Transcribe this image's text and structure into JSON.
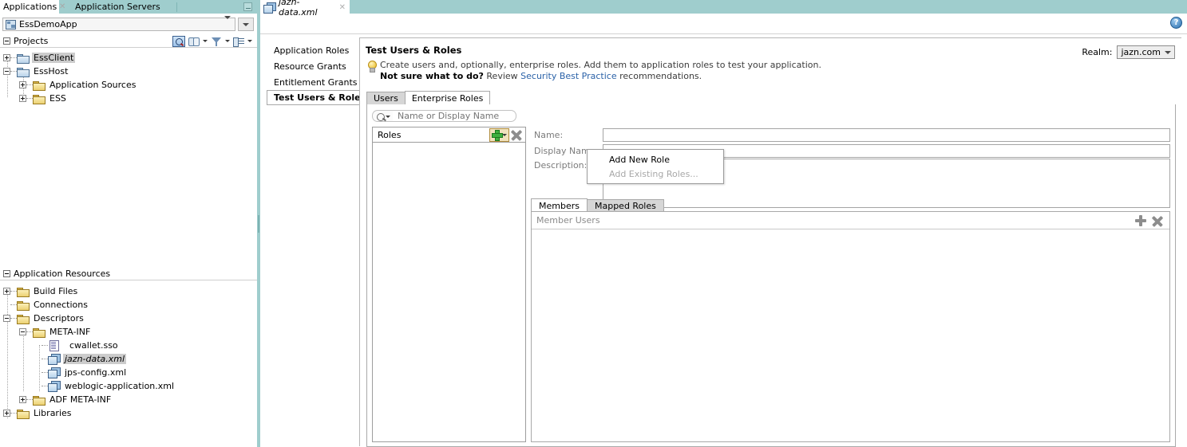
{
  "left_dock": {
    "tabs": [
      {
        "label": "Applications",
        "active": true,
        "closable": true
      },
      {
        "label": "Application Servers",
        "active": false,
        "closable": false
      }
    ],
    "minimize_icon": "minimize-icon",
    "app_selector": {
      "icon": "application-icon",
      "value": "EssDemoApp",
      "dropdown_icon": "chevron-down-icon",
      "secondary_dropdown_icon": "chevron-down-icon"
    },
    "projects_panel": {
      "title": "Projects",
      "collapse_icon": "collapse-icon",
      "tools": [
        {
          "name": "search-projects-icon",
          "has_menu": false
        },
        {
          "name": "working-sets-icon",
          "has_menu": true
        },
        {
          "name": "filter-icon",
          "has_menu": true
        },
        {
          "name": "view-options-icon",
          "has_menu": true
        }
      ],
      "tree": [
        {
          "label": "EssClient",
          "depth": 0,
          "expander": "plus",
          "icon": "folder-blue-icon",
          "selected": true
        },
        {
          "label": "EssHost",
          "depth": 0,
          "expander": "minus",
          "icon": "folder-blue-icon",
          "selected": false
        },
        {
          "label": "Application Sources",
          "depth": 1,
          "expander": "plus",
          "icon": "folder-icon",
          "selected": false
        },
        {
          "label": "ESS",
          "depth": 1,
          "expander": "plus",
          "icon": "folder-icon",
          "selected": false
        }
      ]
    },
    "resources_panel": {
      "title": "Application Resources",
      "collapse_icon": "collapse-icon",
      "tree": [
        {
          "label": "Build Files",
          "depth": 0,
          "expander": "plus",
          "icon": "folder-icon",
          "selected": false,
          "italic": false
        },
        {
          "label": "Connections",
          "depth": 0,
          "expander": "none",
          "icon": "folder-icon",
          "selected": false,
          "italic": false
        },
        {
          "label": "Descriptors",
          "depth": 0,
          "expander": "minus",
          "icon": "folder-icon",
          "selected": false,
          "italic": false
        },
        {
          "label": "META-INF",
          "depth": 1,
          "expander": "minus",
          "icon": "folder-icon",
          "selected": false,
          "italic": false
        },
        {
          "label": "cwallet.sso",
          "depth": 2,
          "expander": "none",
          "icon": "document-icon",
          "selected": false,
          "italic": false
        },
        {
          "label": "jazn-data.xml",
          "depth": 2,
          "expander": "none",
          "icon": "xml-file-icon",
          "selected": true,
          "italic": true
        },
        {
          "label": "jps-config.xml",
          "depth": 2,
          "expander": "none",
          "icon": "xml-file-icon",
          "selected": false,
          "italic": false
        },
        {
          "label": "weblogic-application.xml",
          "depth": 2,
          "expander": "none",
          "icon": "xml-file-icon",
          "selected": false,
          "italic": false
        },
        {
          "label": "ADF META-INF",
          "depth": 1,
          "expander": "plus",
          "icon": "folder-icon",
          "selected": false,
          "italic": false
        },
        {
          "label": "Libraries",
          "depth": 0,
          "expander": "plus",
          "icon": "folder-icon",
          "selected": false,
          "italic": false
        }
      ]
    }
  },
  "editor": {
    "tab": {
      "label": "jazn-data.xml",
      "icon": "xml-file-icon",
      "close_icon": "close-icon"
    },
    "help_icon": "help-icon",
    "help_glyph": "?",
    "nav_items": [
      {
        "label": "Application Roles",
        "active": false
      },
      {
        "label": "Resource Grants",
        "active": false
      },
      {
        "label": "Entitlement Grants",
        "active": false
      },
      {
        "label": "Test Users & Roles",
        "active": true
      }
    ],
    "page": {
      "title": "Test Users & Roles",
      "realm_label": "Realm:",
      "realm_value": "jazn.com",
      "realm_dropdown_icon": "chevron-down-icon",
      "hint_icon": "lightbulb-icon",
      "hint_line1": "Create users and, optionally, enterprise roles. Add them to application roles to test your application.",
      "hint_line2_bold": "Not sure what to do?",
      "hint_line2_mid": " Review ",
      "hint_line2_link": "Security Best Practice",
      "hint_line2_end": " recommendations."
    },
    "inner_tabs": [
      {
        "label": "Users",
        "active": false
      },
      {
        "label": "Enterprise Roles",
        "active": true
      }
    ],
    "search": {
      "icon": "search-icon",
      "dropdown_icon": "chevron-down-icon",
      "placeholder": "Name or Display Name",
      "value": ""
    },
    "roles_list": {
      "header_label": "Roles",
      "add_button": {
        "name": "add-role-button",
        "icon": "plus-icon",
        "dropdown_icon": "chevron-down-icon"
      },
      "remove_button": {
        "name": "remove-role-button",
        "icon": "delete-x-icon"
      },
      "items": []
    },
    "add_menu": {
      "items": [
        {
          "label": "Add New Role",
          "disabled": false
        },
        {
          "label": "Add Existing Roles...",
          "disabled": true
        }
      ]
    },
    "detail_form": {
      "fields": [
        {
          "label": "Name:",
          "value": "",
          "type": "text"
        },
        {
          "label": "Display Name:",
          "value": "",
          "type": "text"
        },
        {
          "label": "Description:",
          "value": "",
          "type": "textarea"
        }
      ]
    },
    "member_tabs": [
      {
        "label": "Members",
        "active": true
      },
      {
        "label": "Mapped Roles",
        "active": false
      }
    ],
    "member_panel": {
      "header_label": "Member Users",
      "add_button": {
        "name": "add-member-button",
        "icon": "plus-icon"
      },
      "remove_button": {
        "name": "remove-member-button",
        "icon": "delete-x-icon"
      },
      "rows": []
    }
  },
  "colors": {
    "tab_teal": "#9fcdcd",
    "selection_gray": "#cccccc",
    "link_blue": "#2b62a8",
    "accent_green": "#3faf3f",
    "menu_disabled": "#a8a8a8"
  }
}
